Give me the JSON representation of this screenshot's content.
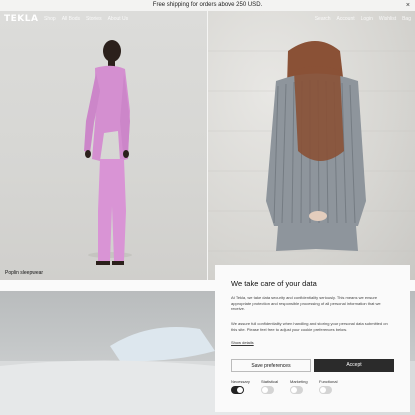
{
  "announcement": {
    "text": "Free shipping for orders above 250 USD.",
    "close": "×"
  },
  "nav": {
    "logo": "TEKLA",
    "links": [
      "Shop",
      "All Bods",
      "Stories",
      "About Us"
    ],
    "right": [
      "Search",
      "Account",
      "Login",
      "Wishlist",
      "Bag"
    ]
  },
  "hero": {
    "left_caption": "Poplin sleepwear"
  },
  "consent": {
    "title": "We take care of your data",
    "para1": "At Tekla, we take data security and confidentiality seriously. This means we ensure appropriate protection and responsible processing of all personal information that we receive.",
    "para2": "We assure full confidentiality when handling and storing your personal data submitted on this site. Please feel free to adjust your cookie preferences below.",
    "show_details": "Show details",
    "save_label": "Save preferences",
    "accept_label": "Accept",
    "toggles": [
      {
        "label": "Necessary",
        "on": true
      },
      {
        "label": "Statistical",
        "on": false
      },
      {
        "label": "Marketing",
        "on": false
      },
      {
        "label": "Functional",
        "on": false
      }
    ]
  }
}
